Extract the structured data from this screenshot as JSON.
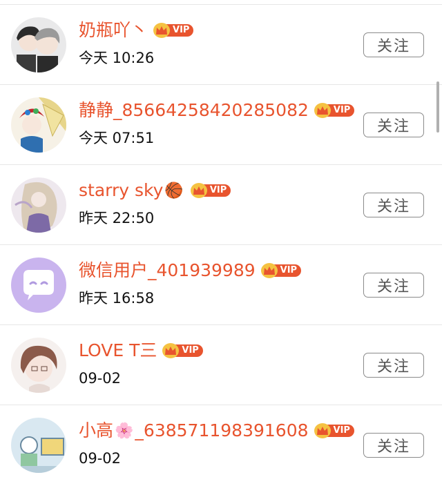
{
  "users": [
    {
      "name": "奶瓶吖丶",
      "vip": "VIP",
      "time": "今天 10:26",
      "follow": "关注",
      "avatar": "anime-duo"
    },
    {
      "name": "静静_85664258420285082",
      "vip": "VIP",
      "time": "今天 07:51",
      "follow": "关注",
      "avatar": "opera"
    },
    {
      "name": "starry sky",
      "suffix_emoji": "🏀",
      "vip": "VIP",
      "time": "昨天 22:50",
      "follow": "关注",
      "avatar": "anime-girl"
    },
    {
      "name": "微信用户_401939989",
      "vip": "VIP",
      "time": "昨天 16:58",
      "follow": "关注",
      "avatar": "wechat-default"
    },
    {
      "name": "LOVE T三",
      "vip": "VIP",
      "time": "09-02",
      "follow": "关注",
      "avatar": "anime-boy"
    },
    {
      "name_prefix": "小高",
      "name_emoji": "🌸",
      "name_suffix": "_638571198391608",
      "vip": "VIP",
      "time": "09-02",
      "follow": "关注",
      "avatar": "cartoon-scene"
    }
  ],
  "colors": {
    "accent": "#e8542e",
    "crown": "#f5c242",
    "divider": "#e6e6e6",
    "button_border": "#8a8a8a"
  }
}
